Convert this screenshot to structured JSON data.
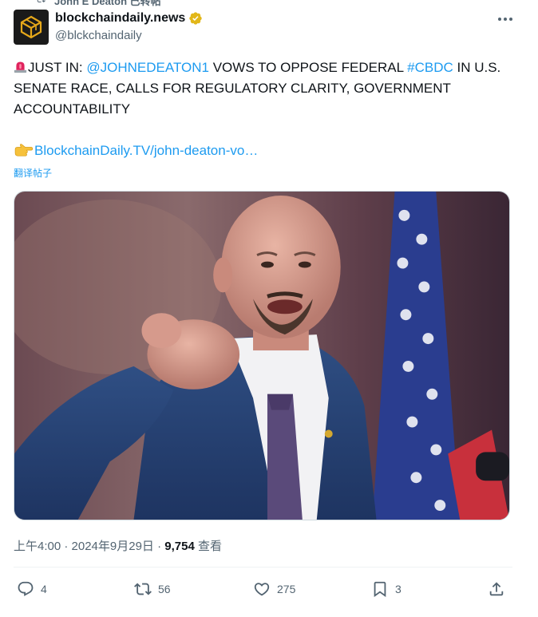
{
  "repost": {
    "label": "John E Deaton 已转帖"
  },
  "author": {
    "display_name": "blockchaindaily.news",
    "handle": "@blckchaindaily"
  },
  "tweet": {
    "prefix": "JUST IN: ",
    "mention": "@JOHNEDEATON1",
    "text_mid": " VOWS TO OPPOSE FEDERAL ",
    "hashtag": "#CBDC",
    "text_end": " IN U.S. SENATE RACE, CALLS FOR REGULATORY CLARITY, GOVERNMENT ACCOUNTABILITY",
    "url": "BlockchainDaily.TV/john-deaton-vo…",
    "translate_label": "翻译帖子"
  },
  "meta": {
    "timestamp": "上午4:00 · 2024年9月29日 · ",
    "views_count": "9,754",
    "views_label": " 查看"
  },
  "actions": {
    "replies": "4",
    "reposts": "56",
    "likes": "275",
    "bookmarks": "3"
  },
  "colors": {
    "link": "#1d9bf0",
    "secondary_text": "#536471",
    "verified_gold": "#e2b719"
  },
  "icons": [
    "repost-icon",
    "blockchain-logo-icon",
    "verified-badge-icon",
    "more-icon",
    "siren-emoji-icon",
    "pointing-hand-icon",
    "reply-icon",
    "retweet-icon",
    "like-icon",
    "bookmark-icon",
    "share-icon"
  ]
}
